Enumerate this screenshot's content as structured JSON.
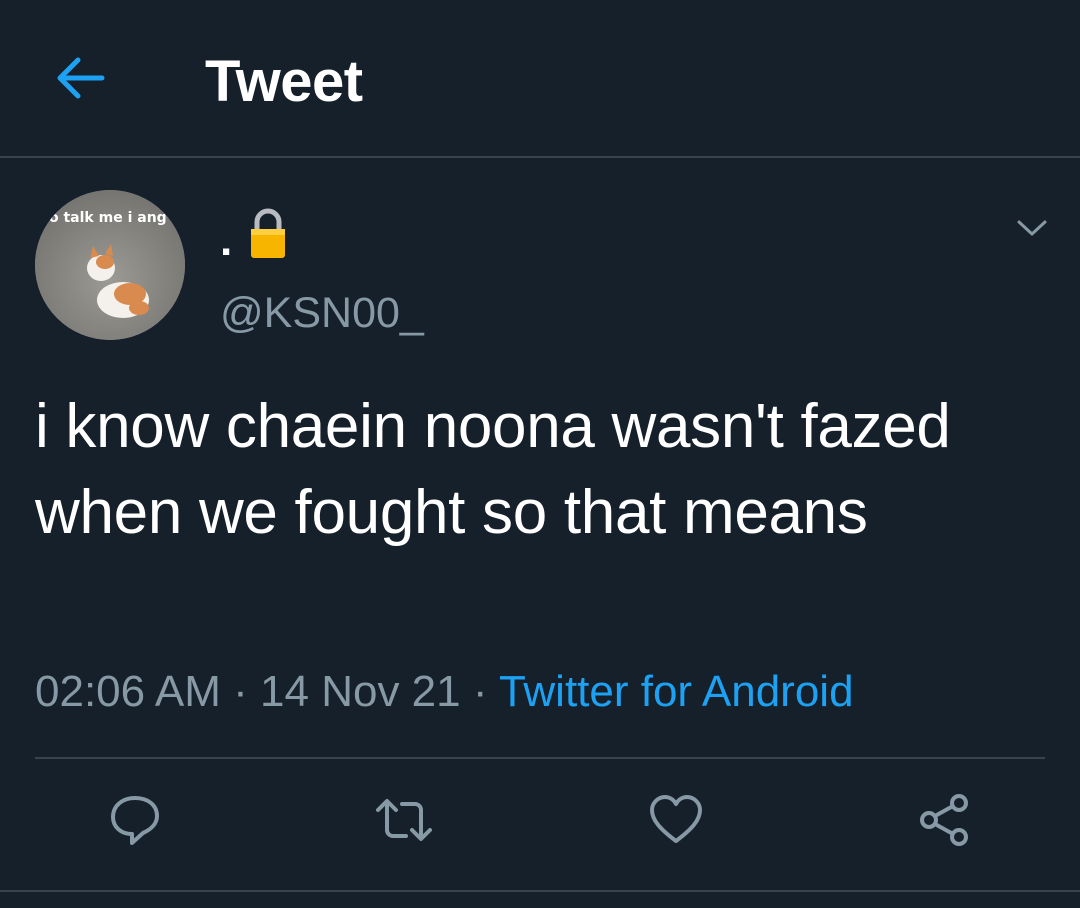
{
  "header": {
    "title": "Tweet",
    "back_icon": "arrow-left-icon"
  },
  "tweet": {
    "avatar_text": "o talk me i ang",
    "display_name": ".",
    "lock_icon": "lock-icon",
    "handle": "@KSN00_",
    "text": "i know chaein noona wasn't fazed when we fought so that means",
    "time": "02:06 AM",
    "date": "14 Nov 21",
    "separator": "·",
    "source": "Twitter for Android"
  },
  "actions": [
    "reply-icon",
    "retweet-icon",
    "like-icon",
    "share-icon"
  ],
  "colors": {
    "background": "#15202b",
    "accent": "#1da1f2",
    "muted": "#8899a6",
    "border": "#38444d"
  }
}
